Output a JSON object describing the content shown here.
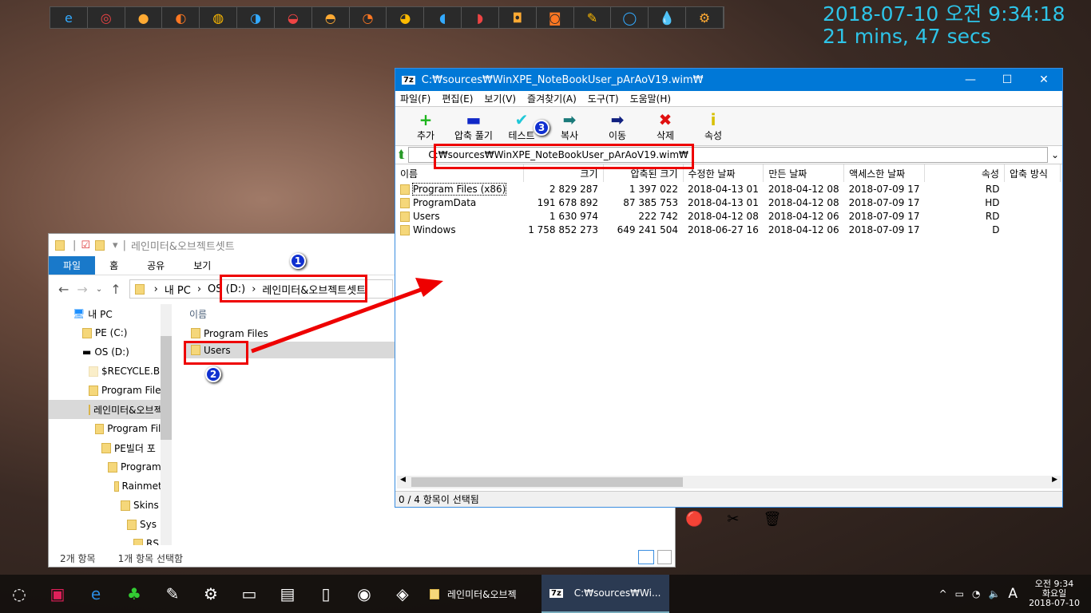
{
  "dock": {
    "icons": [
      "ie-icon",
      "chrome-icon",
      "media-icon",
      "firefox-icon",
      "app-icon",
      "app-icon",
      "app-icon",
      "app-icon",
      "app-icon",
      "app-icon",
      "app-icon",
      "app-icon",
      "app-icon",
      "app-icon",
      "pencil-icon",
      "search-icon",
      "water-icon",
      "settings-icon"
    ]
  },
  "clock": {
    "datetime": "2018-07-10 오전 9:34:18",
    "uptime": "21 mins, 47 secs"
  },
  "zip": {
    "title": "C:₩sources₩WinXPE_NoteBookUser_pArAoV19.wim₩",
    "menu": [
      "파일(F)",
      "편집(E)",
      "보기(V)",
      "즐겨찾기(A)",
      "도구(T)",
      "도움말(H)"
    ],
    "toolbar": [
      {
        "label": "추가",
        "icon": "+",
        "color": "#1db51d"
      },
      {
        "label": "압축 풀기",
        "icon": "▬",
        "color": "#1028c8"
      },
      {
        "label": "테스트",
        "icon": "✔",
        "color": "#20c8d8"
      },
      {
        "label": "복사",
        "icon": "➡",
        "color": "#1a7a7a"
      },
      {
        "label": "이동",
        "icon": "➡",
        "color": "#102080"
      },
      {
        "label": "삭제",
        "icon": "✖",
        "color": "#e01010"
      },
      {
        "label": "속성",
        "icon": "i",
        "color": "#d8c000"
      }
    ],
    "path": "C:₩sources₩WinXPE_NoteBookUser_pArAoV19.wim₩",
    "columns": [
      "이름",
      "크기",
      "압축된 크기",
      "수정한 날짜",
      "만든 날짜",
      "액세스한 날짜",
      "속성",
      "압축 방식"
    ],
    "rows": [
      [
        "Program Files (x86)",
        "2 829 287",
        "1 397 022",
        "2018-04-13 01",
        "2018-04-12 08",
        "2018-07-09 17",
        "RD",
        ""
      ],
      [
        "ProgramData",
        "191 678 892",
        "87 385 753",
        "2018-04-13 01",
        "2018-04-12 08",
        "2018-07-09 17",
        "HD",
        ""
      ],
      [
        "Users",
        "1 630 974",
        "222 742",
        "2018-04-12 08",
        "2018-04-12 06",
        "2018-07-09 17",
        "RD",
        ""
      ],
      [
        "Windows",
        "1 758 852 273",
        "649 241 504",
        "2018-06-27 16",
        "2018-04-12 06",
        "2018-07-09 17",
        "D",
        ""
      ]
    ],
    "status": "0 / 4 항목이 선택됨"
  },
  "explorer": {
    "title": "레인미터&오브젝트셋트",
    "ribbon": [
      "파일",
      "홈",
      "공유",
      "보기"
    ],
    "breadcrumb": [
      "내 PC",
      "OS (D:)",
      "레인미터&오브젝트셋트"
    ],
    "tree": [
      "내 PC",
      "PE (C:)",
      "OS (D:)",
      "$RECYCLE.BIN",
      "Program Files",
      "레인미터&오브젝트셋트",
      "Program Files",
      "PE빌더 포",
      "Program",
      "Rainmeter",
      "Skins",
      "Sys",
      "RS"
    ],
    "column": "이름",
    "files": [
      "Program Files",
      "Users"
    ],
    "status_count": "2개 항목",
    "status_selected": "1개 항목 선택함"
  },
  "annotations": [
    "1",
    "2",
    "3"
  ],
  "taskbar": {
    "apps": [
      {
        "label": "레인미터&오브젝"
      },
      {
        "label": "C:₩sources₩Wi..."
      }
    ],
    "ime": "A",
    "time": "오전 9:34",
    "day": "화요일",
    "date": "2018-07-10"
  }
}
